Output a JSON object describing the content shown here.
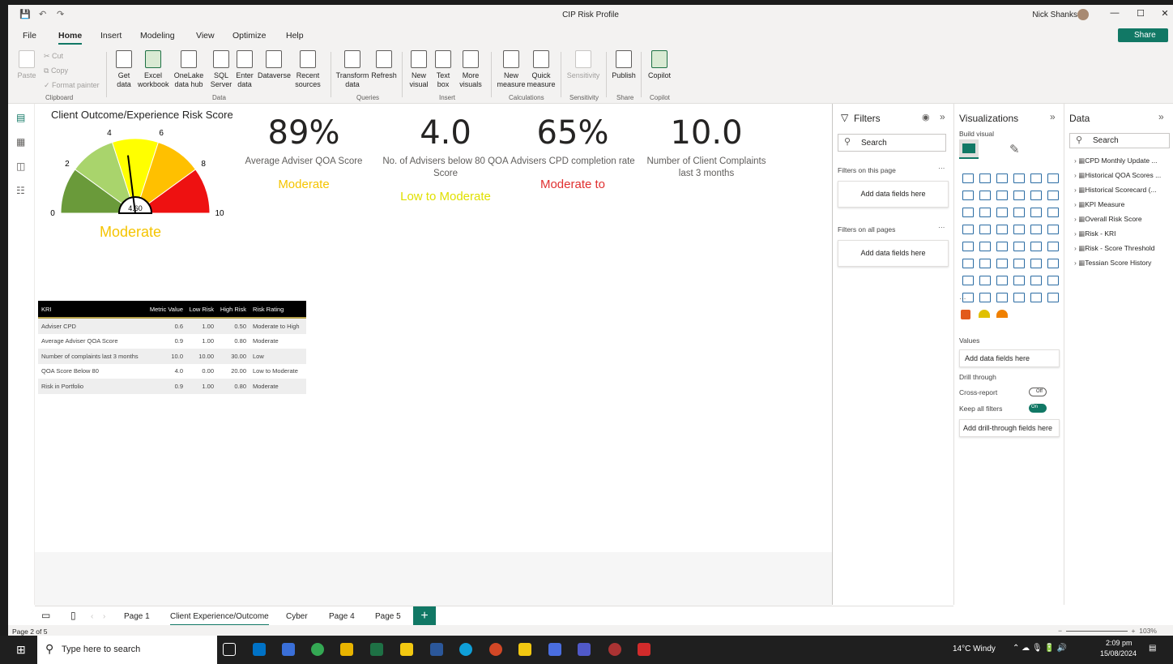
{
  "window": {
    "title": "CIP Risk Profile",
    "user": "Nick Shanks"
  },
  "menus": [
    "File",
    "Home",
    "Insert",
    "Modeling",
    "View",
    "Optimize",
    "Help"
  ],
  "share_label": "Share",
  "ribbon": {
    "clipboard": {
      "paste": "Paste",
      "cut": "Cut",
      "copy": "Copy",
      "format": "Format painter",
      "group": "Clipboard"
    },
    "data": {
      "get": "Get data",
      "excel": "Excel workbook",
      "onelake": "OneLake data hub",
      "sql": "SQL Server",
      "enter": "Enter data",
      "dataverse": "Dataverse",
      "recent": "Recent sources",
      "group": "Data"
    },
    "queries": {
      "transform": "Transform data",
      "refresh": "Refresh",
      "group": "Queries"
    },
    "insert": {
      "visual": "New visual",
      "textbox": "Text box",
      "more": "More visuals",
      "group": "Insert"
    },
    "calc": {
      "measure": "New measure",
      "quick": "Quick measure",
      "group": "Calculations"
    },
    "sensitivity": {
      "label": "Sensitivity",
      "group": "Sensitivity"
    },
    "share": {
      "publish": "Publish",
      "group": "Share"
    },
    "copilot": {
      "label": "Copilot",
      "group": "Copilot"
    }
  },
  "gauge": {
    "title": "Client Outcome/Experience Risk Score",
    "value": "4.60",
    "rating": "Moderate",
    "ticks": [
      "0",
      "2",
      "4",
      "6",
      "8",
      "10"
    ],
    "min": 0,
    "max": 10,
    "needle": 4.6,
    "bands": [
      {
        "from": 0,
        "to": 2,
        "color": "#6a9a3a"
      },
      {
        "from": 2,
        "to": 4,
        "color": "#a9d46c"
      },
      {
        "from": 4,
        "to": 6,
        "color": "#ffff00"
      },
      {
        "from": 6,
        "to": 8,
        "color": "#ffc000"
      },
      {
        "from": 8,
        "to": 10,
        "color": "#ee1111"
      }
    ]
  },
  "cards": [
    {
      "value": "89%",
      "label": "Average Adviser QOA Score",
      "rating": "Moderate",
      "color": "#f5c400"
    },
    {
      "value": "4.0",
      "label": "No. of Advisers below 80 QOA Score",
      "rating": "Low to Moderate",
      "color": "#e0e000"
    },
    {
      "value": "65%",
      "label": "Advisers CPD completion rate",
      "rating": "Moderate to",
      "color": "#e03030"
    },
    {
      "value": "10.0",
      "label": "Number of Client Complaints last 3 months",
      "rating": "",
      "color": "#333"
    }
  ],
  "kri_table": {
    "headers": [
      "KRI",
      "Metric Value",
      "Low Risk",
      "High Risk",
      "Risk Rating"
    ],
    "rows": [
      [
        "Adviser CPD",
        "0.6",
        "1.00",
        "0.50",
        "Moderate to High"
      ],
      [
        "Average Adviser QOA Score",
        "0.9",
        "1.00",
        "0.80",
        "Moderate"
      ],
      [
        "Number of complaints last 3 months",
        "10.0",
        "10.00",
        "30.00",
        "Low"
      ],
      [
        "QOA Score Below 80",
        "4.0",
        "0.00",
        "20.00",
        "Low to Moderate"
      ],
      [
        "Risk in Portfolio",
        "0.9",
        "1.00",
        "0.80",
        "Moderate"
      ]
    ]
  },
  "filters": {
    "title": "Filters",
    "search": "Search",
    "on_page": "Filters on this page",
    "on_all": "Filters on all pages",
    "add": "Add data fields here"
  },
  "viz": {
    "title": "Visualizations",
    "build": "Build visual",
    "values": "Values",
    "add_values": "Add data fields here",
    "drill": "Drill through",
    "cross": "Cross-report",
    "cross_state": "Off",
    "keep": "Keep all filters",
    "keep_state": "On",
    "add_drill": "Add drill-through fields here"
  },
  "data": {
    "title": "Data",
    "search": "Search",
    "tables": [
      "CPD Monthly Update ...",
      "Historical QOA Scores ...",
      "Historical Scorecard (...",
      "KPI Measure",
      "Overall Risk Score",
      "Risk - KRI",
      "Risk - Score Threshold",
      "Tessian Score History"
    ]
  },
  "tabs": [
    "Page 1",
    "Client Experience/Outcome",
    "Cyber",
    "Page 4",
    "Page 5"
  ],
  "status": {
    "page": "Page 2 of 5",
    "zoom": "103%"
  },
  "taskbar": {
    "search": "Type here to search",
    "weather": "14°C  Windy",
    "time": "2:09 pm",
    "date": "15/08/2024"
  }
}
